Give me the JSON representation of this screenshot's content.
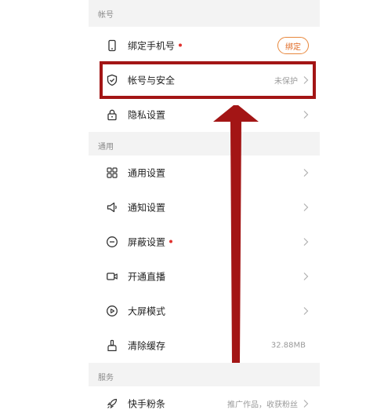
{
  "sections": {
    "account": {
      "title": "帐号"
    },
    "general": {
      "title": "通用"
    },
    "services": {
      "title": "服务"
    }
  },
  "rows": {
    "bind_phone": {
      "label": "绑定手机号",
      "has_dot": true,
      "button_label": "绑定",
      "icon": "phone-icon"
    },
    "account_security": {
      "label": "帐号与安全",
      "value": "未保护",
      "icon": "shield-check-icon"
    },
    "privacy": {
      "label": "隐私设置",
      "icon": "lock-icon"
    },
    "general_settings": {
      "label": "通用设置",
      "icon": "grid-icon"
    },
    "notifications": {
      "label": "通知设置",
      "icon": "speaker-icon"
    },
    "block_settings": {
      "label": "屏蔽设置",
      "has_dot": true,
      "icon": "minus-circle-icon"
    },
    "live": {
      "label": "开通直播",
      "icon": "video-camera-icon"
    },
    "large_screen": {
      "label": "大屏模式",
      "icon": "play-screen-icon"
    },
    "clear_cache": {
      "label": "清除缓存",
      "value": "32.88MB",
      "icon": "broom-icon"
    },
    "kuaishou_fans": {
      "label": "快手粉条",
      "value": "推广作品，收获粉丝",
      "icon": "rocket-icon"
    }
  },
  "colors": {
    "accent": "#e06a24",
    "dot": "#e0322f",
    "annotation": "#a31515",
    "section_bg": "#f3f3f3"
  }
}
